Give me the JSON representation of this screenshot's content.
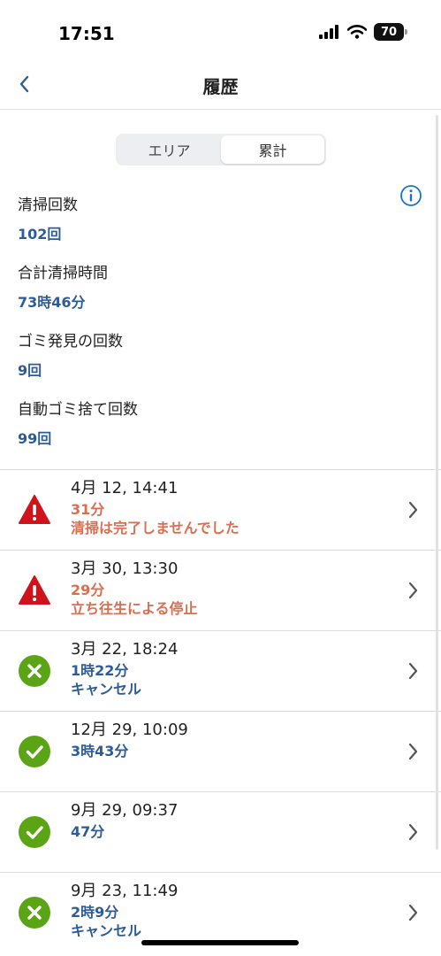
{
  "status_bar": {
    "time": "17:51",
    "battery": "70"
  },
  "nav": {
    "title": "履歴",
    "back_icon": "chevron-left-icon"
  },
  "segments": [
    {
      "label": "エリア",
      "active": false
    },
    {
      "label": "累計",
      "active": true
    }
  ],
  "info_icon": "info-icon",
  "stats": [
    {
      "label": "清掃回数",
      "value": "102回"
    },
    {
      "label": "合計清掃時間",
      "value": "73時46分"
    },
    {
      "label": "ゴミ発見の回数",
      "value": "9回"
    },
    {
      "label": "自動ゴミ捨て回数",
      "value": "99回"
    }
  ],
  "history": [
    {
      "date": "4月 12, 14:41",
      "duration": "31分",
      "status": "清掃は完了しませんでした",
      "icon": "warning-icon",
      "tone": "warn"
    },
    {
      "date": "3月 30, 13:30",
      "duration": "29分",
      "status": "立ち往生による停止",
      "icon": "warning-icon",
      "tone": "warn"
    },
    {
      "date": "3月 22, 18:24",
      "duration": "1時22分",
      "status": "キャンセル",
      "icon": "cancel-icon",
      "tone": "blue"
    },
    {
      "date": "12月 29, 10:09",
      "duration": "3時43分",
      "status": "",
      "icon": "check-icon",
      "tone": "blue"
    },
    {
      "date": "9月 29, 09:37",
      "duration": "47分",
      "status": "",
      "icon": "check-icon",
      "tone": "blue"
    },
    {
      "date": "9月 23, 11:49",
      "duration": "2時9分",
      "status": "キャンセル",
      "icon": "cancel-icon",
      "tone": "blue"
    }
  ],
  "colors": {
    "accent_blue": "#2e5c98",
    "warning_text": "#dd6d4f",
    "warning_icon": "#d0121b",
    "success_icon": "#5aa416",
    "info_icon": "#1a73c8"
  }
}
